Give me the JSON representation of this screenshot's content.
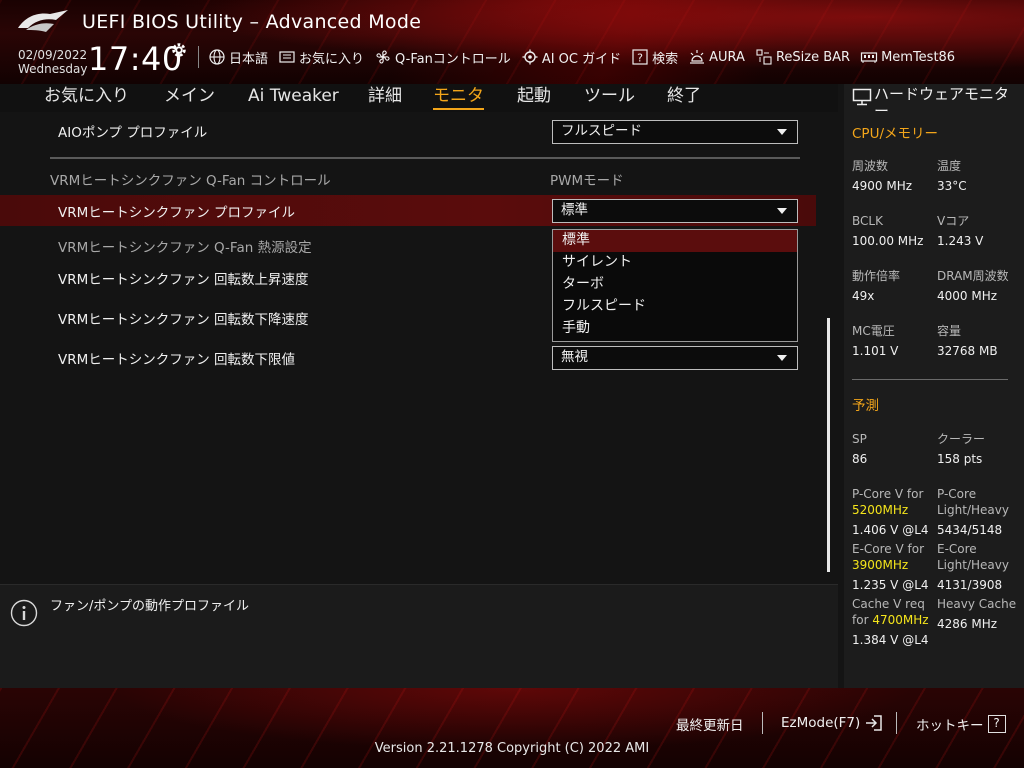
{
  "header": {
    "title": "UEFI BIOS Utility – Advanced Mode",
    "date": "02/09/2022",
    "weekday": "Wednesday",
    "time": "17:40",
    "toolbar": [
      {
        "icon": "globe-icon",
        "label": "日本語"
      },
      {
        "icon": "favorites-icon",
        "label": "お気に入り"
      },
      {
        "icon": "fan-icon",
        "label": "Q-Fanコントロール"
      },
      {
        "icon": "ai-oc-icon",
        "label": "AI OC ガイド"
      },
      {
        "icon": "help-search-icon",
        "label": "検索"
      },
      {
        "icon": "aura-icon",
        "label": "AURA"
      },
      {
        "icon": "resize-bar-icon",
        "label": "ReSize BAR"
      },
      {
        "icon": "memtest-icon",
        "label": "MemTest86"
      }
    ]
  },
  "menu": {
    "items": [
      {
        "label": "お気に入り",
        "active": false
      },
      {
        "label": "メイン",
        "active": false
      },
      {
        "label": "Ai Tweaker",
        "active": false
      },
      {
        "label": "詳細",
        "active": false
      },
      {
        "label": "モニタ",
        "active": true
      },
      {
        "label": "起動",
        "active": false
      },
      {
        "label": "ツール",
        "active": false
      },
      {
        "label": "終了",
        "active": false
      }
    ]
  },
  "main": {
    "aio_pump_profile": {
      "label": "AIOポンプ プロファイル",
      "value": "フルスピード"
    },
    "vrm_qfan_control": {
      "label": "VRMヒートシンクファン Q-Fan コントロール",
      "value": "PWMモード"
    },
    "vrm_profile": {
      "label": "VRMヒートシンクファン プロファイル",
      "value": "標準"
    },
    "vrm_heat_source": {
      "label": "VRMヒートシンクファン Q-Fan 熱源設定"
    },
    "vrm_speed_up": {
      "label": "VRMヒートシンクファン 回転数上昇速度"
    },
    "vrm_speed_down": {
      "label": "VRMヒートシンクファン 回転数下降速度"
    },
    "vrm_speed_low_limit": {
      "label": "VRMヒートシンクファン 回転数下限値",
      "value": "無視"
    },
    "dropdown_options": [
      "標準",
      "サイレント",
      "ターボ",
      "フルスピード",
      "手動"
    ],
    "dropdown_selected": "標準"
  },
  "help": {
    "text": "ファン/ポンプの動作プロファイル"
  },
  "hwmon": {
    "title": "ハードウェアモニター",
    "section_cpu": "CPU/メモリー",
    "cpu": [
      {
        "label": "周波数",
        "value": "4900 MHz"
      },
      {
        "label": "温度",
        "value": "33°C"
      },
      {
        "label": "BCLK",
        "value": "100.00 MHz"
      },
      {
        "label": "Vコア",
        "value": "1.243 V"
      },
      {
        "label": "動作倍率",
        "value": "49x"
      },
      {
        "label": "DRAM周波数",
        "value": "4000 MHz"
      },
      {
        "label": "MC電圧",
        "value": "1.101 V"
      },
      {
        "label": "容量",
        "value": "32768 MB"
      }
    ],
    "section_predict": "予測",
    "predict": {
      "sp_label": "SP",
      "sp_value": "86",
      "cooler_label": "クーラー",
      "cooler_value": "158 pts",
      "pcore_v_label": "P-Core V for",
      "pcore_v_freq": "5200MHz",
      "pcore_v_value": "1.406 V @L4",
      "pcore_lh_label1": "P-Core",
      "pcore_lh_label2": "Light/Heavy",
      "pcore_lh_value": "5434/5148",
      "ecore_v_label": "E-Core V for",
      "ecore_v_freq": "3900MHz",
      "ecore_v_value": "1.235 V @L4",
      "ecore_lh_label1": "E-Core",
      "ecore_lh_label2": "Light/Heavy",
      "ecore_lh_value": "4131/3908",
      "cache_v_label1": "Cache V req",
      "cache_v_label2_prefix": "for ",
      "cache_v_freq": "4700MHz",
      "cache_v_value": "1.384 V @L4",
      "heavy_cache_label": "Heavy Cache",
      "heavy_cache_value": "4286 MHz"
    }
  },
  "footer": {
    "last_modified": "最終更新日",
    "ezmode": "EzMode(F7)",
    "hotkeys": "ホットキー",
    "hotkeys_box": "?",
    "version": "Version 2.21.1278 Copyright (C) 2022 AMI"
  },
  "colors": {
    "accent": "#f2a51a",
    "highlight_row": "#5a0c0c",
    "freq_highlight": "#f5e51b"
  }
}
